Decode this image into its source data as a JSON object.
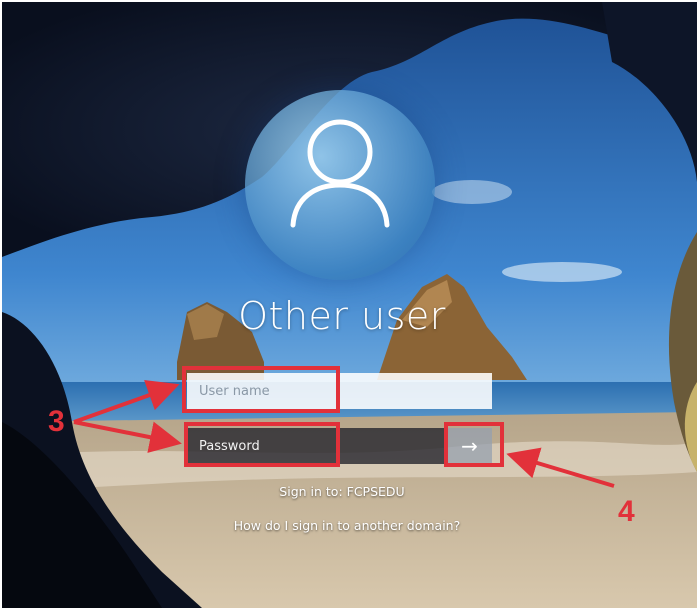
{
  "login": {
    "title": "Other user",
    "username_placeholder": "User name",
    "password_placeholder": "Password",
    "submit_icon": "arrow-right-icon",
    "submit_glyph": "→",
    "sign_in_to": "Sign in to: FCPSEDU",
    "other_domain_link": "How do I sign in to another domain?"
  },
  "annotations": {
    "marker_fields": "3",
    "marker_submit": "4",
    "color": "#e2313a"
  }
}
